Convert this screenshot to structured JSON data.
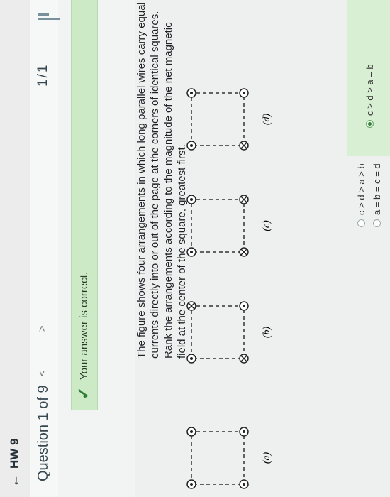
{
  "header": {
    "back_label": "HW 9"
  },
  "question_bar": {
    "title": "Question 1 of 9",
    "prev": "<",
    "next": ">",
    "score": "1/1"
  },
  "feedback": {
    "message": "Your answer is correct."
  },
  "question_text": "The figure shows four arrangements in which long parallel wires carry equal currents directly into or out of the page at the corners of identical squares. Rank the arrangements according to the magnitude of the net magnetic field at the center of the square, greatest first.",
  "figure": {
    "labels": [
      "(a)",
      "(b)",
      "(c)",
      "(d)"
    ]
  },
  "answers": [
    {
      "label": "c > d > a > b",
      "selected": false
    },
    {
      "label": "a = b = c = d",
      "selected": false
    },
    {
      "label": "c > d > a = b",
      "selected": true
    }
  ],
  "colors": {
    "correct_bg": "#cdeac6",
    "check": "#2e7d32"
  },
  "icons": {
    "back": "arrow-left-icon",
    "check": "check-icon",
    "menu": "menu-icon"
  }
}
